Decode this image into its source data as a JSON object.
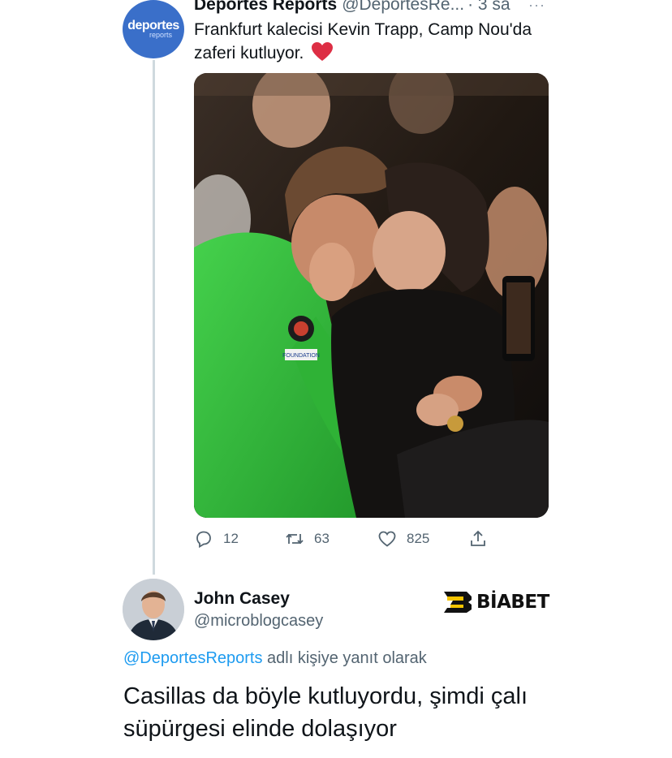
{
  "tweet": {
    "avatar_brand": "deportes",
    "avatar_sub": "reports",
    "name": "Deportes Reports",
    "handle": "@DeportesRe...",
    "time": "· 3 sa",
    "more_label": "···",
    "text": "Frankfurt kalecisi Kevin Trapp, Camp Nou'da zaferi kutluyor.",
    "photo_badge": "FOUNDATION",
    "actions": {
      "reply_count": "12",
      "retweet_count": "63",
      "like_count": "825"
    }
  },
  "reply": {
    "name": "John Casey",
    "handle": "@microblogcasey",
    "replying_to_mention": "@DeportesReports",
    "replying_to_suffix": " adlı kişiye yanıt olarak",
    "text": "Casillas da böyle kutluyordu, şimdi çalı süpürgesi elinde dolaşıyor"
  },
  "watermark": {
    "logo_letter": "B",
    "text": "BİABET"
  },
  "colors": {
    "link_blue": "#1d9bf0",
    "muted_gray": "#536471",
    "thread_line": "#cfd9de",
    "avatar_blue": "#3a6fc9",
    "kit_green": "#35c43e",
    "heart_red": "#e0245e"
  },
  "icons": {
    "reply": "reply-bubble-icon",
    "retweet": "retweet-icon",
    "like": "heart-icon",
    "share": "share-icon",
    "more": "more-dots-icon"
  }
}
